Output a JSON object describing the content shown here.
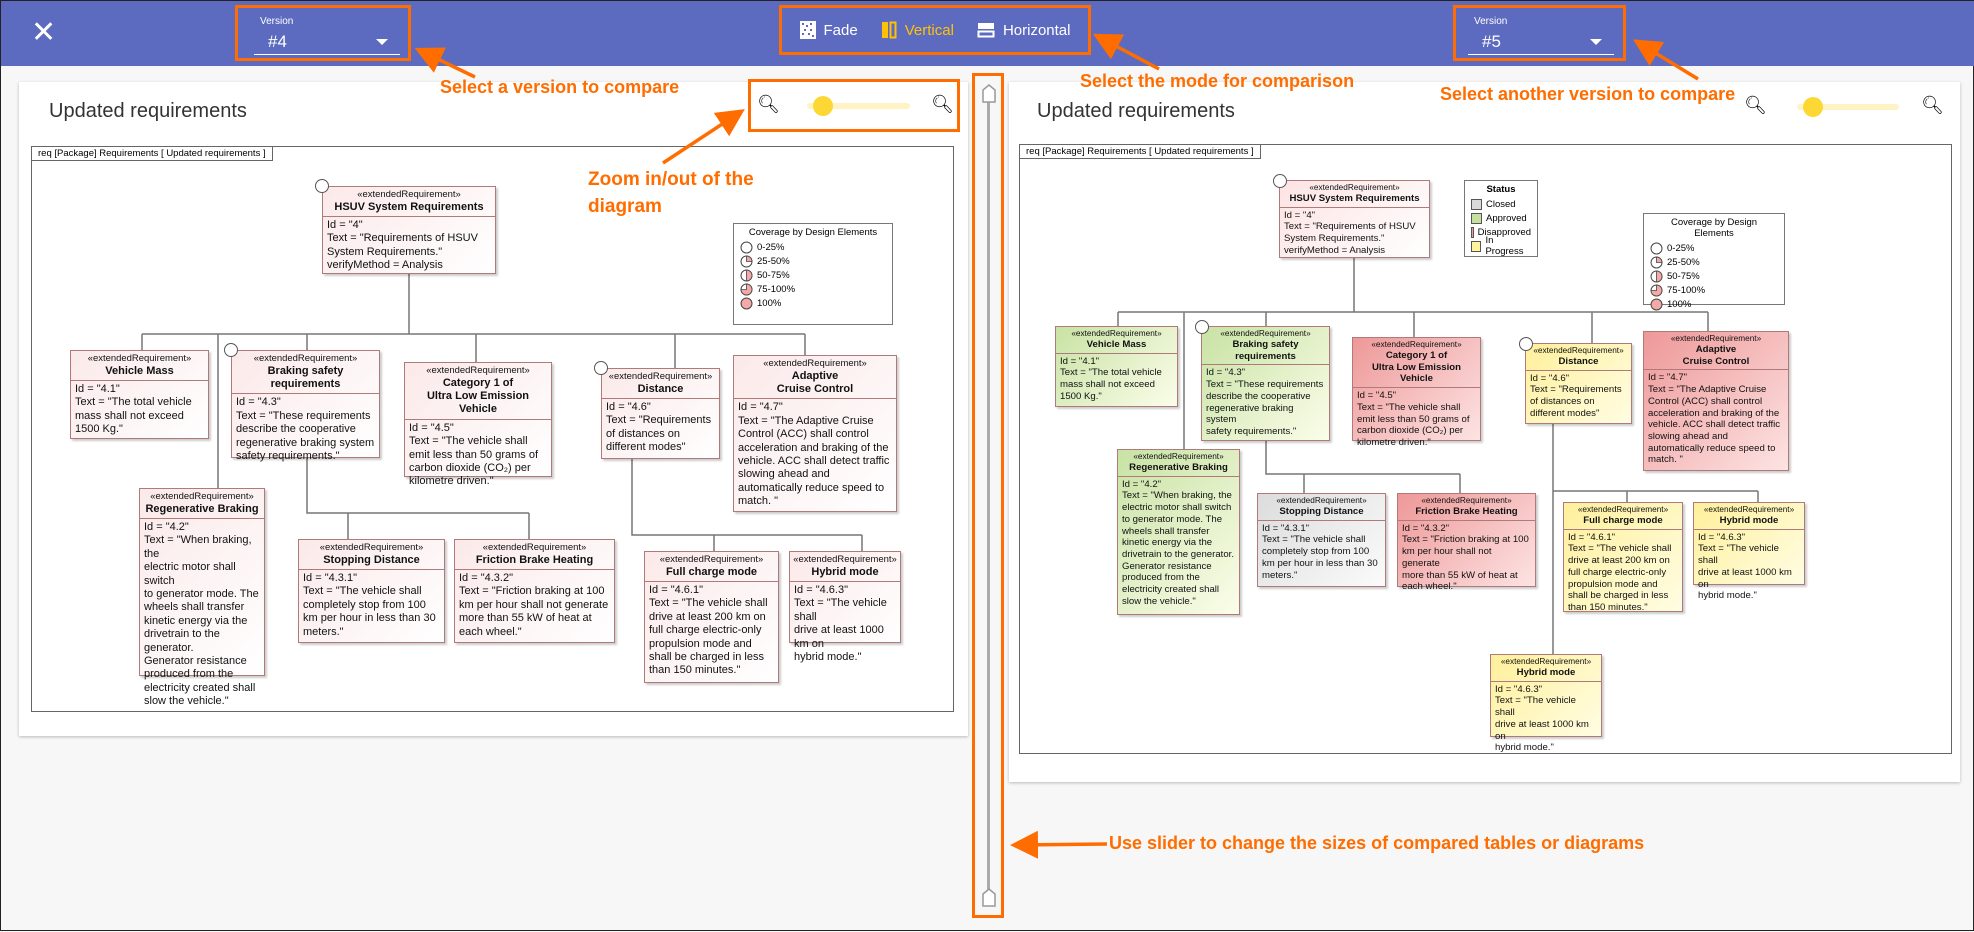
{
  "header": {
    "close_icon": "close-icon",
    "left_version": {
      "label": "Version",
      "value": "#4"
    },
    "right_version": {
      "label": "Version",
      "value": "#5"
    },
    "modes": [
      {
        "label": "Fade",
        "icon": "fade-icon",
        "active": false
      },
      {
        "label": "Vertical",
        "icon": "vertical-split-icon",
        "active": true
      },
      {
        "label": "Horizontal",
        "icon": "horizontal-split-icon",
        "active": false
      }
    ]
  },
  "annotations": {
    "select_version": "Select a version to compare",
    "select_mode": "Select the mode for comparison",
    "select_another": "Select another version to compare",
    "zoom_line1": "Zoom in/out of the",
    "zoom_line2": "diagram",
    "slider": "Use slider to change the sizes of compared tables or diagrams"
  },
  "colors": {
    "accent": "#5c6bc0",
    "highlight": "#ff6d00",
    "active_mode": "#ffc107",
    "zoom_thumb": "#fdd835"
  },
  "left_panel": {
    "title": "Updated requirements",
    "frame_label": "req  [Package]  Requirements [ Updated requirements  ]",
    "zoom_level": 0.1,
    "coverage_legend": {
      "title": "Coverage by Design Elements",
      "items": [
        "0-25%",
        "25-50%",
        "50-75%",
        "75-100%",
        "100%"
      ]
    },
    "boxes": {
      "hsuv": {
        "stereotype": "«extendedRequirement»",
        "name": "HSUV System Requirements",
        "lines": [
          "Id = \"4\"",
          "Text = \"Requirements of HSUV",
          "System Requirements.\"",
          "verifyMethod = Analysis"
        ]
      },
      "vm": {
        "stereotype": "«extendedRequirement»",
        "name": "Vehicle Mass",
        "lines": [
          "Id = \"4.1\"",
          "Text = \"The total vehicle",
          "mass shall not exceed",
          "1500 Kg.\""
        ]
      },
      "brk": {
        "stereotype": "«extendedRequirement»",
        "name": "Braking safety requirements",
        "lines": [
          "Id = \"4.3\"",
          "Text = \"These requirements",
          "describe the cooperative",
          "regenerative braking system",
          "safety requirements.\""
        ]
      },
      "cat1": {
        "stereotype": "«extendedRequirement»",
        "name": "Category 1 of\nUltra Low Emission Vehicle",
        "lines": [
          "Id = \"4.5\"",
          "Text = \"The vehicle shall",
          "emit less than 50 grams of",
          "carbon dioxide (CO₂) per",
          "kilometre driven.\""
        ]
      },
      "dist": {
        "stereotype": "«extendedRequirement»",
        "name": "Distance",
        "lines": [
          "Id = \"4.6\"",
          "Text = \"Requirements",
          "of distances on",
          "different modes\""
        ]
      },
      "acc": {
        "stereotype": "«extendedRequirement»",
        "name": "Adaptive\nCruise Control",
        "lines": [
          "Id = \"4.7\"",
          "Text = \"The Adaptive Cruise",
          "Control (ACC) shall control",
          "acceleration and braking of the",
          "vehicle. ACC shall detect traffic",
          "slowing ahead and",
          "automatically reduce speed to",
          "match. \""
        ]
      },
      "regen": {
        "stereotype": "«extendedRequirement»",
        "name": "Regenerative Braking",
        "lines": [
          "Id = \"4.2\"",
          "Text = \"When braking, the",
          "electric motor shall switch",
          "to generator mode. The",
          "wheels shall transfer",
          "kinetic energy via the",
          "drivetrain to the generator.",
          "Generator resistance",
          "produced from the",
          "electricity created shall",
          "slow the vehicle.\""
        ]
      },
      "stop": {
        "stereotype": "«extendedRequirement»",
        "name": "Stopping Distance",
        "lines": [
          "Id = \"4.3.1\"",
          "Text = \"The vehicle shall",
          "completely stop from 100",
          "km per hour in less than 30",
          "meters.\""
        ]
      },
      "fric": {
        "stereotype": "«extendedRequirement»",
        "name": "Friction Brake Heating",
        "lines": [
          "Id = \"4.3.2\"",
          "Text = \"Friction braking at 100",
          "km per hour shall not generate",
          "more than 55 kW of heat at",
          "each wheel.\""
        ]
      },
      "full": {
        "stereotype": "«extendedRequirement»",
        "name": "Full charge mode",
        "lines": [
          "Id = \"4.6.1\"",
          "Text = \"The vehicle shall",
          "drive at least 200 km on",
          "full charge electric-only",
          "propulsion mode and",
          "shall be charged in less",
          "than 150 minutes.\""
        ]
      },
      "hyb": {
        "stereotype": "«extendedRequirement»",
        "name": "Hybrid mode",
        "lines": [
          "Id = \"4.6.3\"",
          "Text = \"The vehicle shall",
          "drive at least 1000 km on",
          "hybrid mode.\""
        ]
      }
    }
  },
  "right_panel": {
    "title": "Updated requirements",
    "frame_label": "req  [Package]  Requirements [ Updated requirements  ]",
    "zoom_level": 0.1,
    "status_legend": {
      "title": "Status",
      "items": [
        {
          "label": "Closed",
          "color": "#d9d9d9"
        },
        {
          "label": "Approved",
          "color": "#c6e0a0"
        },
        {
          "label": "Disapproved",
          "color": "#ee9a9a"
        },
        {
          "label": "In Progress",
          "color": "#fff59d"
        }
      ]
    },
    "coverage_legend": {
      "title": "Coverage by Design Elements",
      "items": [
        "0-25%",
        "25-50%",
        "50-75%",
        "75-100%",
        "100%"
      ]
    },
    "boxes": {
      "hsuv": {
        "status": "pink",
        "stereotype": "«extendedRequirement»",
        "name": "HSUV System Requirements",
        "lines": [
          "Id = \"4\"",
          "Text = \"Requirements of HSUV",
          "System Requirements.\"",
          "verifyMethod = Analysis"
        ]
      },
      "vm": {
        "status": "green",
        "stereotype": "«extendedRequirement»",
        "name": "Vehicle Mass",
        "lines": [
          "Id = \"4.1\"",
          "Text = \"The total vehicle",
          "mass shall not exceed",
          "1500 Kg.\""
        ]
      },
      "brk": {
        "status": "green",
        "stereotype": "«extendedRequirement»",
        "name": "Braking safety requirements",
        "lines": [
          "Id = \"4.3\"",
          "Text = \"These requirements",
          "describe the cooperative",
          "regenerative braking system",
          "safety requirements.\""
        ]
      },
      "cat1": {
        "status": "red",
        "stereotype": "«extendedRequirement»",
        "name": "Category 1 of\nUltra Low Emission Vehicle",
        "lines": [
          "Id = \"4.5\"",
          "Text = \"The vehicle shall",
          "emit less than 50 grams of",
          "carbon dioxide (CO₂) per",
          "kilometre driven.\""
        ]
      },
      "dist": {
        "status": "yellow",
        "stereotype": "«extendedRequirement»",
        "name": "Distance",
        "lines": [
          "Id = \"4.6\"",
          "Text = \"Requirements",
          "of distances on",
          "different modes\""
        ]
      },
      "acc": {
        "status": "red",
        "stereotype": "«extendedRequirement»",
        "name": "Adaptive\nCruise Control",
        "lines": [
          "Id = \"4.7\"",
          "Text = \"The Adaptive Cruise",
          "Control (ACC) shall control",
          "acceleration and braking of the",
          "vehicle. ACC shall detect traffic",
          "slowing ahead and",
          "automatically reduce speed to",
          "match. \""
        ]
      },
      "regen": {
        "status": "green",
        "stereotype": "«extendedRequirement»",
        "name": "Regenerative Braking",
        "lines": [
          "Id = \"4.2\"",
          "Text = \"When braking, the",
          "electric motor shall switch",
          "to generator mode. The",
          "wheels shall transfer",
          "kinetic energy via the",
          "drivetrain to the generator.",
          "Generator resistance",
          "produced from the",
          "electricity created shall",
          "slow the vehicle.\""
        ]
      },
      "stop": {
        "status": "gray",
        "stereotype": "«extendedRequirement»",
        "name": "Stopping Distance",
        "lines": [
          "Id = \"4.3.1\"",
          "Text = \"The vehicle shall",
          "completely stop from 100",
          "km per hour in less than 30",
          "meters.\""
        ]
      },
      "fric": {
        "status": "red",
        "stereotype": "«extendedRequirement»",
        "name": "Friction Brake Heating",
        "lines": [
          "Id = \"4.3.2\"",
          "Text = \"Friction braking at 100",
          "km per hour shall not generate",
          "more than 55 kW of heat at",
          "each wheel.\""
        ]
      },
      "full": {
        "status": "yellow",
        "stereotype": "«extendedRequirement»",
        "name": "Full charge mode",
        "lines": [
          "Id = \"4.6.1\"",
          "Text = \"The vehicle shall",
          "drive at least 200 km on",
          "full charge electric-only",
          "propulsion mode and",
          "shall be charged in less",
          "than 150 minutes.\""
        ]
      },
      "hyb": {
        "status": "yellow",
        "stereotype": "«extendedRequirement»",
        "name": "Hybrid mode",
        "lines": [
          "Id = \"4.6.3\"",
          "Text = \"The vehicle shall",
          "drive at least 1000 km on",
          "hybrid mode.\""
        ]
      },
      "hyb2": {
        "status": "yellow",
        "stereotype": "«extendedRequirement»",
        "name": "Hybrid mode",
        "lines": [
          "Id = \"4.6.3\"",
          "Text = \"The vehicle shall",
          "drive at least 1000 km on",
          "hybrid mode.\""
        ]
      }
    }
  }
}
